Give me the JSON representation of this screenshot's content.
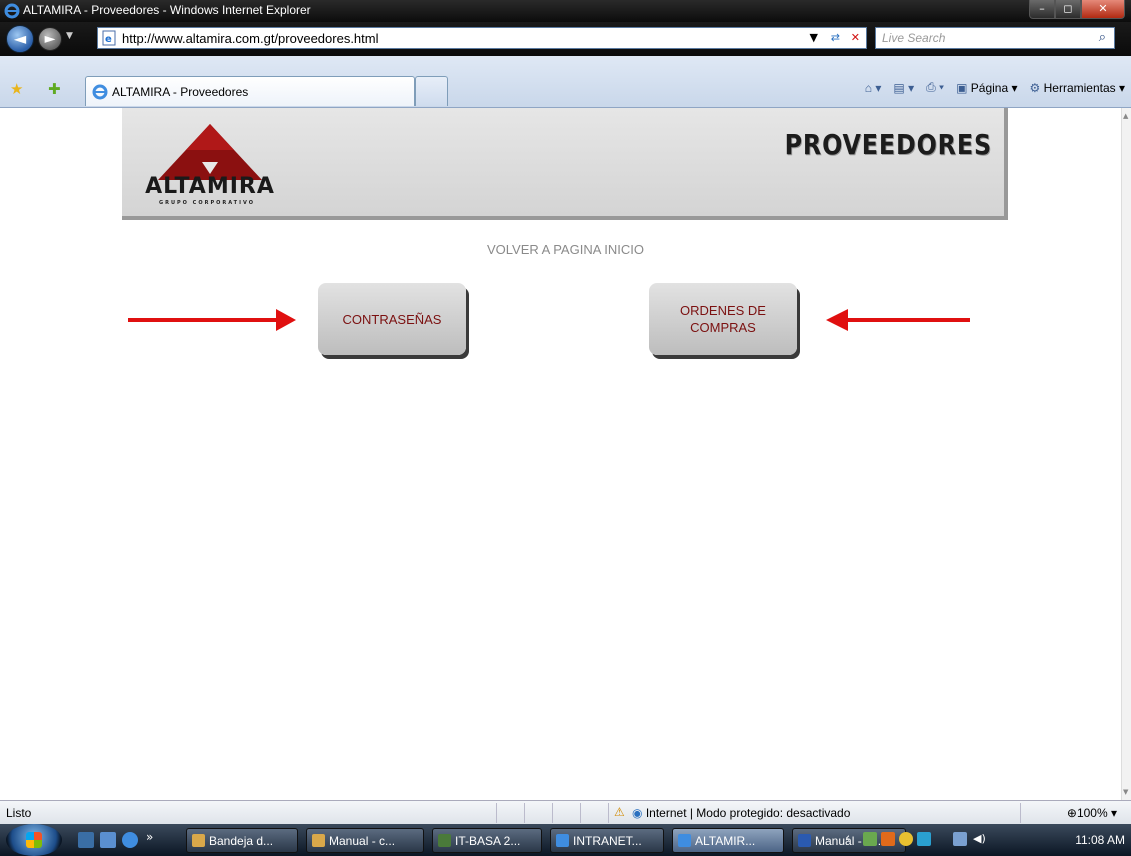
{
  "window": {
    "title": "ALTAMIRA - Proveedores - Windows Internet Explorer",
    "minimize_label": "–",
    "maximize_label": "◻",
    "close_label": "✕"
  },
  "address_bar": {
    "url": "http://www.altamira.com.gt/proveedores.html",
    "search_placeholder": "Live Search"
  },
  "tabs": [
    {
      "label": "ALTAMIRA - Proveedores"
    }
  ],
  "command_bar": {
    "page_label": "Página",
    "tools_label": "Herramientas"
  },
  "page": {
    "banner_title": "PROVEEDORES",
    "logo_text": "ALTAMIRA",
    "logo_subtext": "GRUPO CORPORATIVO",
    "back_link": "VOLVER A PAGINA INICIO",
    "button_contrasenas": "CONTRASEÑAS",
    "button_ordenes_line1": "ORDENES DE",
    "button_ordenes_line2": "COMPRAS",
    "arrow_color": "#e01010",
    "button_text_color": "#7b1010"
  },
  "status_bar": {
    "status": "Listo",
    "zone": "Internet | Modo protegido: desactivado",
    "zoom": "100%"
  },
  "taskbar": {
    "items": [
      {
        "label": "Bandeja d..."
      },
      {
        "label": "Manual - c..."
      },
      {
        "label": "IT-BASA 2..."
      },
      {
        "label": "INTRANET..."
      },
      {
        "label": "ALTAMIR..."
      },
      {
        "label": "Manual - c..."
      }
    ],
    "clock": "11:08 AM"
  }
}
